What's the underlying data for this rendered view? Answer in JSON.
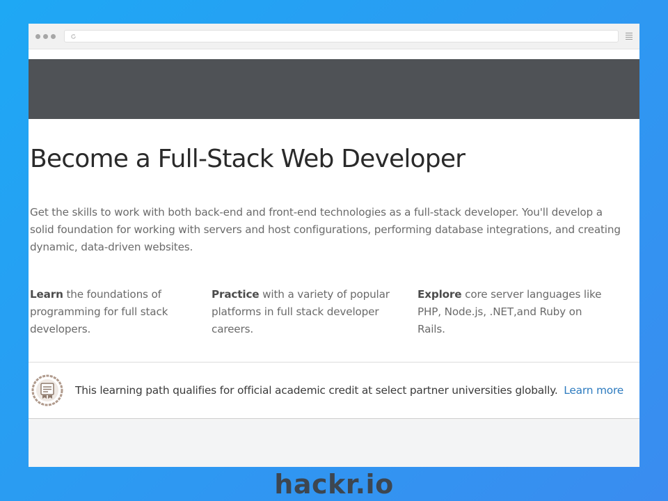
{
  "browser": {
    "url": "",
    "icons": [
      "window-dots-icon",
      "reload-icon",
      "menu-icon"
    ]
  },
  "page": {
    "title": "Become a Full-Stack Web Developer",
    "intro": "Get the skills to work with both back-end and front-end technologies as a full-stack developer. You'll develop a solid foundation for working with servers and host configurations, performing database integrations, and creating dynamic, data-driven websites.",
    "features": [
      {
        "lead": "Learn",
        "text": "the foundations of programming for full stack developers."
      },
      {
        "lead": "Practice",
        "text": "with a variety of popular platforms in full stack developer careers."
      },
      {
        "lead": "Explore",
        "text": "core server languages like PHP, Node.js, .NET,and Ruby on Rails."
      }
    ],
    "credit": {
      "text": "This learning path qualifies for official academic credit at select partner universities globally.",
      "link": "Learn more"
    }
  },
  "watermark": "hackr.io",
  "colors": {
    "background": "#1ea8f4",
    "hero_band": "#4f5256",
    "link": "#2d7bbf",
    "logo": "#3d4650"
  }
}
